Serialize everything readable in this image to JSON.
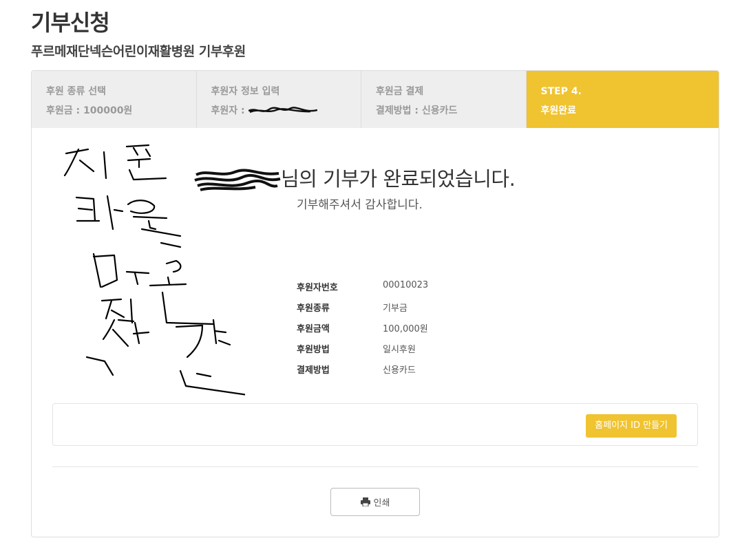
{
  "header": {
    "title": "기부신청",
    "subtitle": "푸르메재단넥슨어린이재활병원 기부후원"
  },
  "steps": [
    {
      "line1": "후원 종류 선택",
      "line2": "후원금 : 100000원"
    },
    {
      "line1": "후원자 정보 입력",
      "line2": "후원자 : "
    },
    {
      "line1": "후원금 결제",
      "line2": "결제방법 : 신용카드"
    },
    {
      "line1": "STEP 4.",
      "line2": "후원완료"
    }
  ],
  "completion": {
    "message_suffix": "님의 기부가 완료되었습니다.",
    "thanks": "기부해주셔서 감사합니다."
  },
  "details": [
    {
      "label": "후원자번호",
      "value": "00010023"
    },
    {
      "label": "후원종류",
      "value": "기부금"
    },
    {
      "label": "후원금액",
      "value": "100,000원"
    },
    {
      "label": "후원방법",
      "value": "일시후원"
    },
    {
      "label": "결제방법",
      "value": "신용카드"
    }
  ],
  "actions": {
    "make_id": "홈페이지 ID 만들기",
    "print": "인쇄"
  },
  "colors": {
    "accent": "#f0c330",
    "step_inactive_bg": "#eeeeee"
  },
  "icons": {
    "print": "print-icon"
  }
}
